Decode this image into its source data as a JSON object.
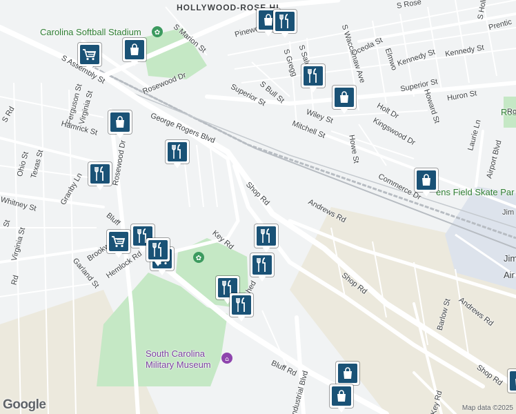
{
  "map": {
    "area_label": "HOLLYWOOD-ROSE HI",
    "copyright": "Map data ©2025",
    "google_logo": "Google",
    "poi": {
      "softball": "Carolina Softball Stadium",
      "museum_line1": "South Carolina",
      "museum_line2": "Military Museum",
      "skate_park": "ens Field Skate Par",
      "airport_line1": "Jim",
      "airport_line2": "Air",
      "rose_partial": "Ros"
    },
    "streets": {
      "s_marion": "S Marion St",
      "pinewood": "Pinewo",
      "rosewood_dr": "Rosewood Dr",
      "s_assembly": "S Assembly St",
      "ferguson": "Ferguson St",
      "virginia1": "Virginia St",
      "hamrick": "Hamrick St",
      "rosewood_dr2": "Rosewood Dr",
      "george_rogers": "George Rogers Blvd",
      "superior1": "Superior St",
      "s_bull": "S Bull St",
      "s_gregg": "S Gregg",
      "s_saluda": "S Salu",
      "s_waccamaw": "S Waccamaw Ave",
      "oceola": "Oceola St",
      "elmwood": "Elmwo",
      "kennedy1": "Kennedy St",
      "kennedy2": "Kennedy St",
      "s_rose": "S Rose",
      "superior2": "Superior St",
      "huron": "Huron St",
      "holt": "Holt Dr",
      "howard": "Howard St",
      "wiley": "Wiley St",
      "mitchell": "Mitchell St",
      "kingswood": "Kingswood Dr",
      "howe": "Howe St",
      "laurel_ln": "Laurie Ln",
      "airport_blvd": "Airport Blvd",
      "commerce": "Commerce Dr",
      "andrews1": "Andrews Rd",
      "shop1": "Shop Rd",
      "key_rd1": "Key Rd",
      "bluff1": "Bluff",
      "shop2": "Shop Rd",
      "andrews2": "Andrews Rd",
      "barlow": "Barlow St",
      "shop3": "Shop Rd",
      "bluff2": "Bluff Rd",
      "industrial": "Industrial Blvd",
      "key_rd2": "Key Rd",
      "ohio": "Ohio St",
      "texas": "Texas St",
      "whitney": "Whitney St",
      "granby": "Granby Ln",
      "virginia2": "Virginia St",
      "brookwood": "Brookwo",
      "hemlock": "Hemlock Rd",
      "garland": "Garland St",
      "jim_partial": "Jim",
      "prentice": "Prentic",
      "s_holly": "S Holly",
      "s_rd": "S Rd",
      "st_partial": "St",
      "hed": "hed",
      "rd_partial": "Rd",
      "rose_top": "Rose"
    },
    "colors": {
      "marker_bg": "#1a5276",
      "park": "#c5e8c5",
      "road": "#ffffff",
      "land": "#f1f3f4"
    },
    "markers": [
      {
        "id": "shopping-marker-1",
        "type": "shopping"
      },
      {
        "id": "shopping-marker-2",
        "type": "shopping"
      },
      {
        "id": "shopping-marker-3",
        "type": "shopping"
      },
      {
        "id": "shopping-marker-4",
        "type": "shopping"
      },
      {
        "id": "shopping-marker-5",
        "type": "shopping"
      },
      {
        "id": "shopping-marker-6",
        "type": "shopping"
      },
      {
        "id": "shopping-marker-7",
        "type": "shopping"
      },
      {
        "id": "shopping-marker-8",
        "type": "shopping"
      },
      {
        "id": "grocery-marker-1",
        "type": "grocery"
      },
      {
        "id": "grocery-marker-2",
        "type": "grocery"
      },
      {
        "id": "grocery-marker-3",
        "type": "grocery"
      },
      {
        "id": "restaurant-marker-1",
        "type": "restaurant"
      },
      {
        "id": "restaurant-marker-2",
        "type": "restaurant"
      },
      {
        "id": "restaurant-marker-3",
        "type": "restaurant"
      },
      {
        "id": "restaurant-marker-4",
        "type": "restaurant"
      },
      {
        "id": "restaurant-marker-5",
        "type": "restaurant"
      },
      {
        "id": "restaurant-marker-6",
        "type": "restaurant"
      },
      {
        "id": "restaurant-marker-7",
        "type": "restaurant"
      },
      {
        "id": "restaurant-marker-8",
        "type": "restaurant"
      },
      {
        "id": "restaurant-marker-9",
        "type": "restaurant"
      },
      {
        "id": "restaurant-marker-10",
        "type": "restaurant"
      }
    ]
  }
}
